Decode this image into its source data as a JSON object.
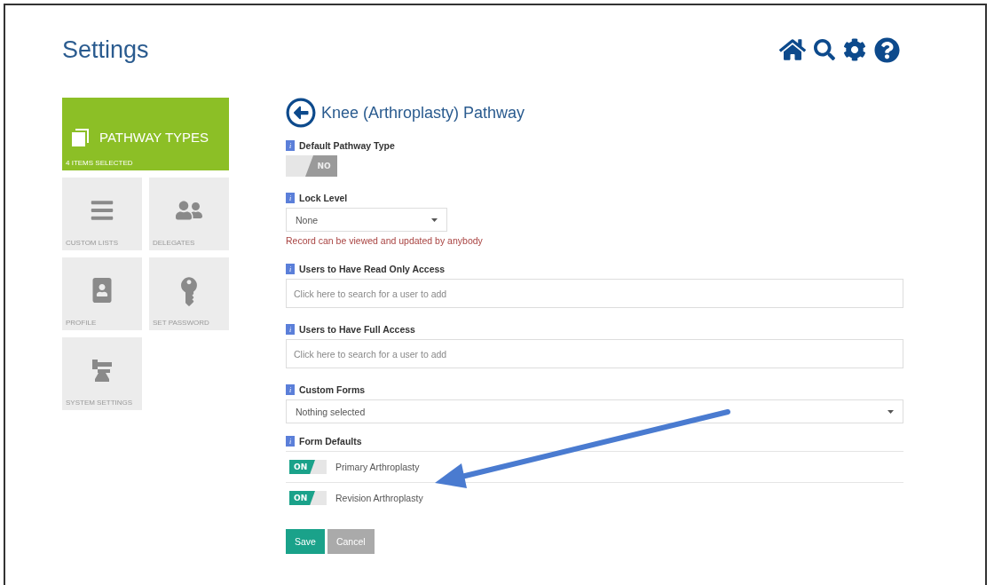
{
  "header": {
    "title": "Settings"
  },
  "sidebar": {
    "items": [
      {
        "kind": "pages",
        "label": "PATHWAY TYPES",
        "caption": "4 ITEMS SELECTED",
        "selected": true
      },
      {
        "kind": "list",
        "label": "CUSTOM LISTS",
        "selected": false
      },
      {
        "kind": "people",
        "label": "DELEGATES",
        "selected": false
      },
      {
        "kind": "profile",
        "label": "PROFILE",
        "selected": false
      },
      {
        "kind": "key",
        "label": "SET PASSWORD",
        "selected": false
      },
      {
        "kind": "anvil",
        "label": "SYSTEM SETTINGS",
        "selected": false
      }
    ]
  },
  "form": {
    "title": "Knee (Arthroplasty) Pathway",
    "fields": [
      {
        "kind": "toggle",
        "info": "i",
        "label": "Default Pathway Type",
        "toggle": {
          "on": false,
          "text": "NO"
        }
      },
      {
        "kind": "select",
        "info": "i",
        "label": "Lock Level",
        "value": "None",
        "hint": "Record can be viewed and updated by anybody"
      },
      {
        "kind": "search",
        "info": "i",
        "label": "Users to Have Read Only Access",
        "placeholder": "Click here to search for a user to add"
      },
      {
        "kind": "search",
        "info": "i",
        "label": "Users to Have Full Access",
        "placeholder": "Click here to search for a user to add"
      },
      {
        "kind": "wide-select",
        "info": "i",
        "label": "Custom Forms",
        "value": "Nothing selected"
      },
      {
        "kind": "toggle-list",
        "info": "i",
        "label": "Form Defaults",
        "rows": [
          {
            "on": true,
            "text": "ON",
            "label": "Primary Arthroplasty"
          },
          {
            "on": true,
            "text": "ON",
            "label": "Revision Arthroplasty"
          }
        ]
      }
    ],
    "buttons": [
      {
        "kind": "primary",
        "label": "Save"
      },
      {
        "kind": "secondary",
        "label": "Cancel"
      }
    ]
  }
}
